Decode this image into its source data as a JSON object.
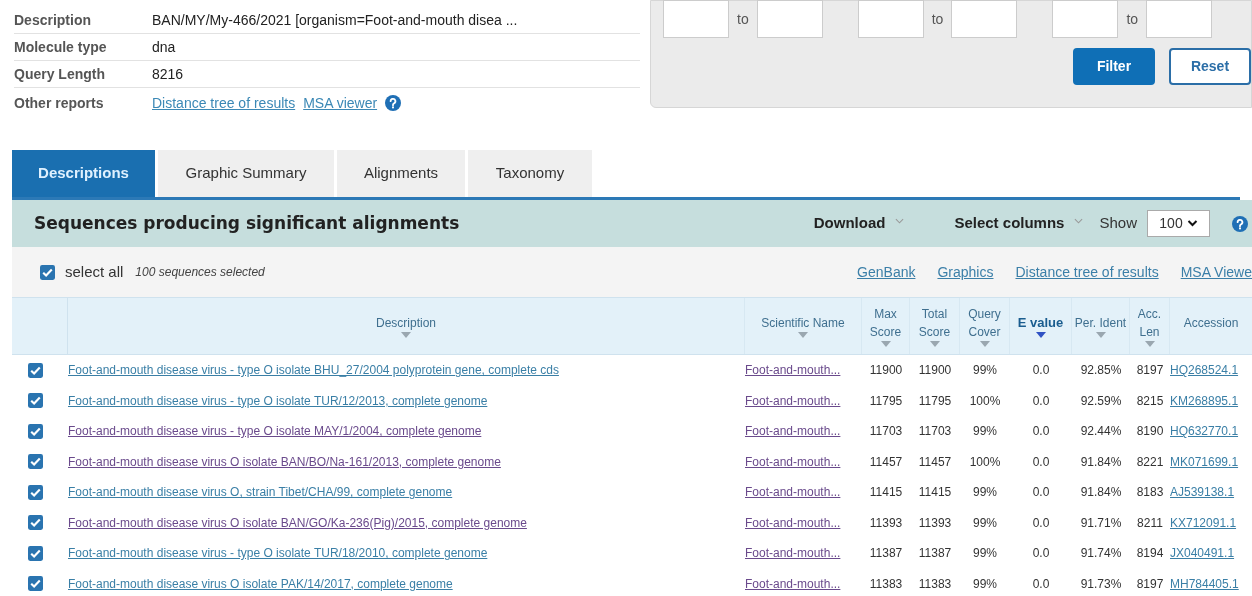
{
  "summary": [
    {
      "label": "Description",
      "value": "BAN/MY/My-466/2021 [organism=Foot-and-mouth disea ..."
    },
    {
      "label": "Molecule type",
      "value": "dna"
    },
    {
      "label": "Query Length",
      "value": "8216"
    }
  ],
  "other_reports": {
    "label": "Other reports",
    "links": [
      "Distance tree of results",
      "MSA viewer"
    ]
  },
  "filter": {
    "ranges": [
      {
        "separator": "to"
      },
      {
        "separator": "to"
      },
      {
        "separator": "to"
      }
    ],
    "buttons": [
      {
        "label": "Filter",
        "kind": "primary"
      },
      {
        "label": "Reset",
        "kind": "secondary"
      }
    ]
  },
  "tabs": [
    {
      "label": "Descriptions",
      "selected": true
    },
    {
      "label": "Graphic Summary",
      "selected": false
    },
    {
      "label": "Alignments",
      "selected": false
    },
    {
      "label": "Taxonomy",
      "selected": false
    }
  ],
  "results": {
    "title": "Sequences producing significant alignments",
    "menus": [
      "Download",
      "Select columns"
    ],
    "show_label": "Show",
    "show_value": "100",
    "select_all": {
      "label": "select all",
      "checked": true,
      "count": "100 sequences selected"
    },
    "links": [
      "GenBank",
      "Graphics",
      "Distance tree of results",
      "MSA Viewe"
    ],
    "columns": [
      {
        "label": "Description",
        "kind": "title_link",
        "sorted": false
      },
      {
        "label": "Scientific Name",
        "kind": "name_link",
        "sorted": false
      },
      {
        "label": "Max Score",
        "kind": "number",
        "sorted": false
      },
      {
        "label": "Total Score",
        "kind": "number",
        "sorted": false
      },
      {
        "label": "Query Cover",
        "kind": "number",
        "sorted": false
      },
      {
        "label": "E value",
        "kind": "number",
        "sorted": true
      },
      {
        "label": "Per. Ident",
        "kind": "number",
        "sorted": false
      },
      {
        "label": "Acc. Len",
        "kind": "number",
        "sorted": false
      },
      {
        "label": "Accession",
        "kind": "link",
        "sorted": false
      }
    ],
    "rows": [
      {
        "checked": true,
        "visited": false,
        "cells": [
          "Foot-and-mouth disease virus - type O isolate BHU_27/2004 polyprotein gene, complete cds",
          "Foot-and-mouth...",
          "11900",
          "11900",
          "99%",
          "0.0",
          "92.85%",
          "8197",
          "HQ268524.1"
        ]
      },
      {
        "checked": true,
        "visited": false,
        "cells": [
          "Foot-and-mouth disease virus - type O isolate TUR/12/2013, complete genome",
          "Foot-and-mouth...",
          "11795",
          "11795",
          "100%",
          "0.0",
          "92.59%",
          "8215",
          "KM268895.1"
        ]
      },
      {
        "checked": true,
        "visited": true,
        "cells": [
          "Foot-and-mouth disease virus - type O isolate MAY/1/2004, complete genome",
          "Foot-and-mouth...",
          "11703",
          "11703",
          "99%",
          "0.0",
          "92.44%",
          "8190",
          "HQ632770.1"
        ]
      },
      {
        "checked": true,
        "visited": true,
        "cells": [
          "Foot-and-mouth disease virus O isolate BAN/BO/Na-161/2013, complete genome",
          "Foot-and-mouth...",
          "11457",
          "11457",
          "100%",
          "0.0",
          "91.84%",
          "8221",
          "MK071699.1"
        ]
      },
      {
        "checked": true,
        "visited": false,
        "cells": [
          "Foot-and-mouth disease virus O, strain Tibet/CHA/99, complete genome",
          "Foot-and-mouth...",
          "11415",
          "11415",
          "99%",
          "0.0",
          "91.84%",
          "8183",
          "AJ539138.1"
        ]
      },
      {
        "checked": true,
        "visited": true,
        "cells": [
          "Foot-and-mouth disease virus O isolate BAN/GO/Ka-236(Pig)/2015, complete genome",
          "Foot-and-mouth...",
          "11393",
          "11393",
          "99%",
          "0.0",
          "91.71%",
          "8211",
          "KX712091.1"
        ]
      },
      {
        "checked": true,
        "visited": false,
        "cells": [
          "Foot-and-mouth disease virus - type O isolate TUR/18/2010, complete genome",
          "Foot-and-mouth...",
          "11387",
          "11387",
          "99%",
          "0.0",
          "91.74%",
          "8194",
          "JX040491.1"
        ]
      },
      {
        "checked": true,
        "visited": false,
        "cells": [
          "Foot-and-mouth disease virus O isolate PAK/14/2017, complete genome",
          "Foot-and-mouth...",
          "11383",
          "11383",
          "99%",
          "0.0",
          "91.73%",
          "8197",
          "MH784405.1"
        ]
      }
    ]
  }
}
